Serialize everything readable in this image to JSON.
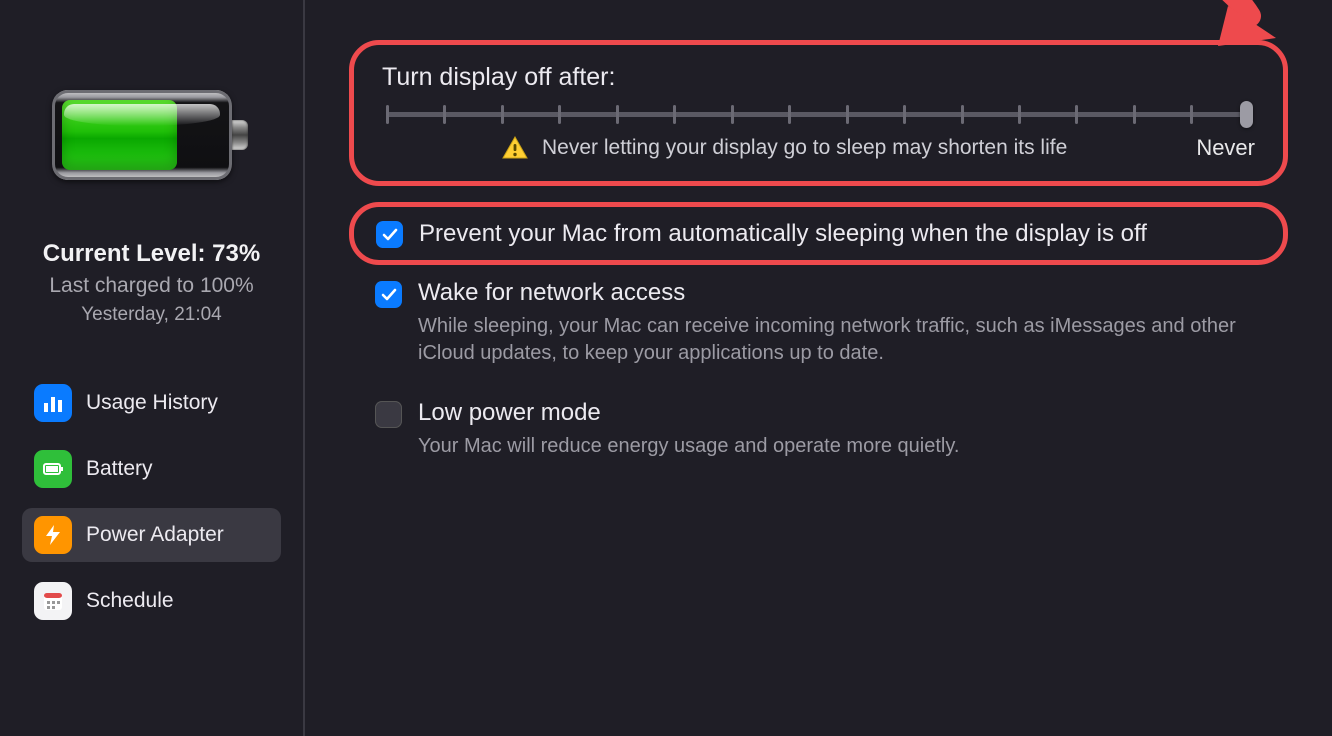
{
  "sidebar": {
    "current_level_label": "Current Level: 73%",
    "last_charged_label": "Last charged to 100%",
    "last_charged_when": "Yesterday, 21:04",
    "items": [
      {
        "label": "Usage History"
      },
      {
        "label": "Battery"
      },
      {
        "label": "Power Adapter"
      },
      {
        "label": "Schedule"
      }
    ],
    "selected_index": 2
  },
  "main": {
    "display_off": {
      "title": "Turn display off after:",
      "warning": "Never letting your display go to sleep may shorten its life",
      "value_label": "Never",
      "tick_count": 16
    },
    "options": [
      {
        "label": "Prevent your Mac from automatically sleeping when the display is off",
        "checked": true,
        "highlighted": true
      },
      {
        "label": "Wake for network access",
        "description": "While sleeping, your Mac can receive incoming network traffic, such as iMessages and other iCloud updates, to keep your applications up to date.",
        "checked": true
      },
      {
        "label": "Low power mode",
        "description": "Your Mac will reduce energy usage and operate more quietly.",
        "checked": false
      }
    ]
  },
  "annotation": {
    "arrow_color": "#ee4a4d",
    "highlight_color": "#ee4a4d"
  }
}
